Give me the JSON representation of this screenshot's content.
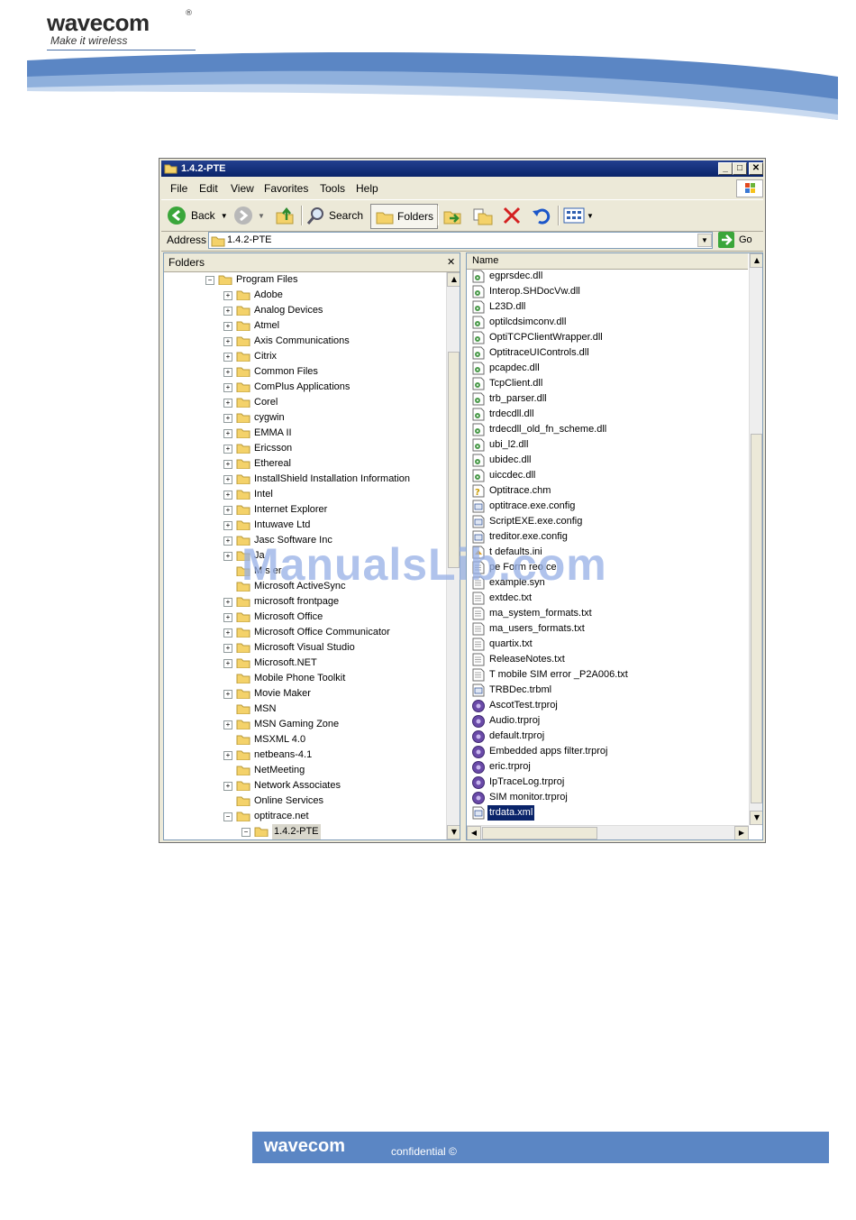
{
  "header": {
    "logo": "wavecom",
    "tagline": "Make it wireless"
  },
  "window": {
    "title": "1.4.2-PTE",
    "controls": {
      "minimize": "_",
      "maximize": "□",
      "close": "✕"
    },
    "menu": [
      "File",
      "Edit",
      "View",
      "Favorites",
      "Tools",
      "Help"
    ],
    "toolbar": {
      "back": "Back",
      "search": "Search",
      "folders": "Folders"
    },
    "address": {
      "label": "Address",
      "value": "1.4.2-PTE",
      "go": "Go"
    },
    "folders_pane": {
      "title": "Folders",
      "close": "✕",
      "tree": [
        {
          "label": "Program Files",
          "level": 0,
          "expander": "minus"
        },
        {
          "label": "Adobe",
          "level": 1,
          "expander": "plus"
        },
        {
          "label": "Analog Devices",
          "level": 1,
          "expander": "plus"
        },
        {
          "label": "Atmel",
          "level": 1,
          "expander": "plus"
        },
        {
          "label": "Axis Communications",
          "level": 1,
          "expander": "plus"
        },
        {
          "label": "Citrix",
          "level": 1,
          "expander": "plus"
        },
        {
          "label": "Common Files",
          "level": 1,
          "expander": "plus"
        },
        {
          "label": "ComPlus Applications",
          "level": 1,
          "expander": "plus"
        },
        {
          "label": "Corel",
          "level": 1,
          "expander": "plus"
        },
        {
          "label": "cygwin",
          "level": 1,
          "expander": "plus"
        },
        {
          "label": "EMMA II",
          "level": 1,
          "expander": "plus"
        },
        {
          "label": "Ericsson",
          "level": 1,
          "expander": "plus"
        },
        {
          "label": "Ethereal",
          "level": 1,
          "expander": "plus"
        },
        {
          "label": "InstallShield Installation Information",
          "level": 1,
          "expander": "plus"
        },
        {
          "label": "Intel",
          "level": 1,
          "expander": "plus"
        },
        {
          "label": "Internet Explorer",
          "level": 1,
          "expander": "plus"
        },
        {
          "label": "Intuwave Ltd",
          "level": 1,
          "expander": "plus"
        },
        {
          "label": "Jasc Software Inc",
          "level": 1,
          "expander": "plus"
        },
        {
          "label": "Ja",
          "level": 1,
          "expander": "plus"
        },
        {
          "label": "M  s  er",
          "level": 1,
          "expander": "none"
        },
        {
          "label": "Microsoft ActiveSync",
          "level": 1,
          "expander": "none"
        },
        {
          "label": "microsoft frontpage",
          "level": 1,
          "expander": "plus"
        },
        {
          "label": "Microsoft Office",
          "level": 1,
          "expander": "plus"
        },
        {
          "label": "Microsoft Office Communicator",
          "level": 1,
          "expander": "plus"
        },
        {
          "label": "Microsoft Visual Studio",
          "level": 1,
          "expander": "plus"
        },
        {
          "label": "Microsoft.NET",
          "level": 1,
          "expander": "plus"
        },
        {
          "label": "Mobile Phone Toolkit",
          "level": 1,
          "expander": "none"
        },
        {
          "label": "Movie Maker",
          "level": 1,
          "expander": "plus"
        },
        {
          "label": "MSN",
          "level": 1,
          "expander": "none"
        },
        {
          "label": "MSN Gaming Zone",
          "level": 1,
          "expander": "plus"
        },
        {
          "label": "MSXML 4.0",
          "level": 1,
          "expander": "none"
        },
        {
          "label": "netbeans-4.1",
          "level": 1,
          "expander": "plus"
        },
        {
          "label": "NetMeeting",
          "level": 1,
          "expander": "none"
        },
        {
          "label": "Network Associates",
          "level": 1,
          "expander": "plus"
        },
        {
          "label": "Online Services",
          "level": 1,
          "expander": "none"
        },
        {
          "label": "optitrace.net",
          "level": 1,
          "expander": "minus"
        },
        {
          "label": "1.4.2-PTE",
          "level": 2,
          "expander": "minus",
          "selected": true
        }
      ]
    },
    "file_list": {
      "column": "Name",
      "files": [
        {
          "name": "egprsdec.dll",
          "icon": "dll-icon"
        },
        {
          "name": "Interop.SHDocVw.dll",
          "icon": "dll-icon"
        },
        {
          "name": "L23D.dll",
          "icon": "dll-icon"
        },
        {
          "name": "optilcdsimconv.dll",
          "icon": "dll-icon"
        },
        {
          "name": "OptiTCPClientWrapper.dll",
          "icon": "dll-icon"
        },
        {
          "name": "OptitraceUIControls.dll",
          "icon": "dll-icon"
        },
        {
          "name": "pcapdec.dll",
          "icon": "dll-icon"
        },
        {
          "name": "TcpClient.dll",
          "icon": "dll-icon"
        },
        {
          "name": "trb_parser.dll",
          "icon": "dll-icon"
        },
        {
          "name": "trdecdll.dll",
          "icon": "dll-icon"
        },
        {
          "name": "trdecdll_old_fn_scheme.dll",
          "icon": "dll-icon"
        },
        {
          "name": "ubi_l2.dll",
          "icon": "dll-icon"
        },
        {
          "name": "ubidec.dll",
          "icon": "dll-icon"
        },
        {
          "name": "uiccdec.dll",
          "icon": "dll-icon"
        },
        {
          "name": "Optitrace.chm",
          "icon": "help-file-icon"
        },
        {
          "name": "optitrace.exe.config",
          "icon": "config-file-icon"
        },
        {
          "name": "ScriptEXE.exe.config",
          "icon": "config-file-icon"
        },
        {
          "name": "treditor.exe.config",
          "icon": "config-file-icon"
        },
        {
          "name": "t  defaults.ini",
          "icon": "ini-file-icon"
        },
        {
          "name": "  pe Form  reo  ce",
          "icon": "text-file-icon"
        },
        {
          "name": "example.syn",
          "icon": "syn-file-icon"
        },
        {
          "name": "extdec.txt",
          "icon": "text-file-icon"
        },
        {
          "name": "ma_system_formats.txt",
          "icon": "text-file-icon"
        },
        {
          "name": "ma_users_formats.txt",
          "icon": "text-file-icon"
        },
        {
          "name": "quartix.txt",
          "icon": "text-file-icon"
        },
        {
          "name": "ReleaseNotes.txt",
          "icon": "text-file-icon"
        },
        {
          "name": "T mobile SIM error _P2A006.txt",
          "icon": "text-file-icon"
        },
        {
          "name": "TRBDec.trbml",
          "icon": "trbml-file-icon"
        },
        {
          "name": "AscotTest.trproj",
          "icon": "trproj-file-icon"
        },
        {
          "name": "Audio.trproj",
          "icon": "trproj-file-icon"
        },
        {
          "name": "default.trproj",
          "icon": "trproj-file-icon"
        },
        {
          "name": "Embedded apps filter.trproj",
          "icon": "trproj-file-icon"
        },
        {
          "name": "eric.trproj",
          "icon": "trproj-file-icon"
        },
        {
          "name": "IpTraceLog.trproj",
          "icon": "trproj-file-icon"
        },
        {
          "name": "SIM monitor.trproj",
          "icon": "trproj-file-icon"
        },
        {
          "name": "trdata.xml",
          "icon": "xml-file-icon",
          "selected": true
        }
      ]
    }
  },
  "watermark": "ManualsLib.com",
  "footer": {
    "logo": "wavecom",
    "text": "confidential ©"
  },
  "colors": {
    "accent": "#5b86c4",
    "title_bar": "#0a246a",
    "selection": "#0a246a",
    "chrome": "#ece9d8"
  }
}
